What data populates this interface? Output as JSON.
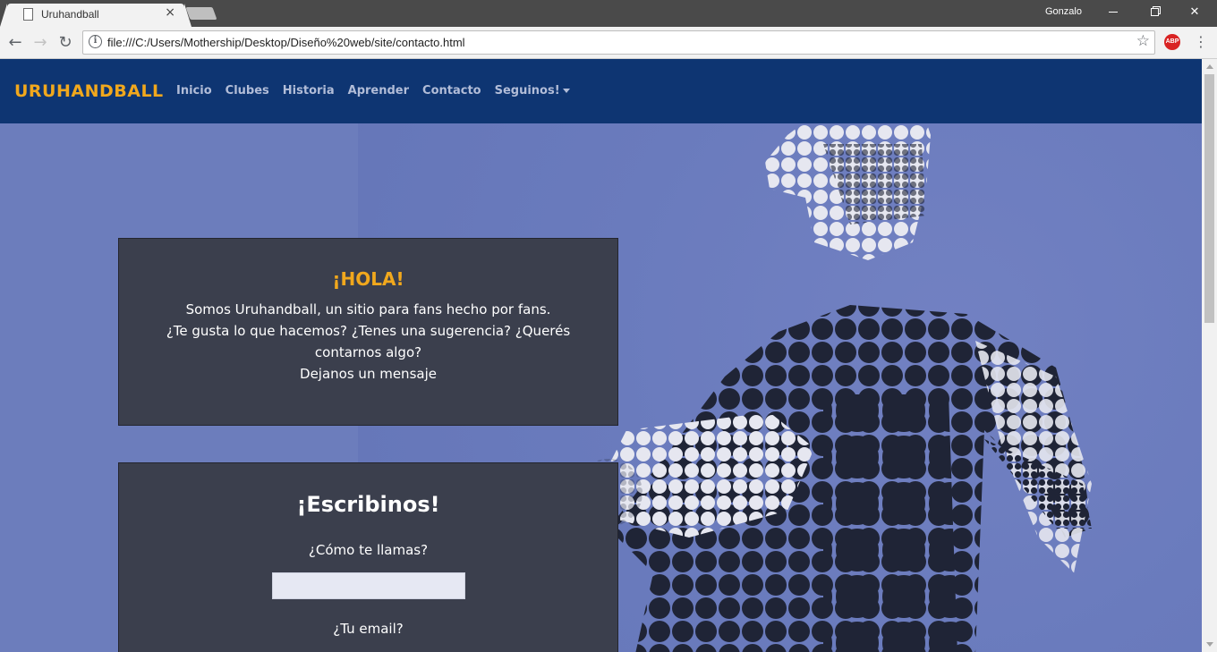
{
  "browser": {
    "tab_title": "Uruhandball",
    "tab_close": "×",
    "profile_name": "Gonzalo",
    "url": "file:///C:/Users/Mothership/Desktop/Diseño%20web/site/contacto.html",
    "abp_label": "ABP"
  },
  "site": {
    "brand": "URUHANDBALL",
    "nav": [
      "Inicio",
      "Clubes",
      "Historia",
      "Aprender",
      "Contacto",
      "Seguinos!"
    ]
  },
  "hola": {
    "heading": "¡HOLA!",
    "lines": [
      "Somos Uruhandball, un sitio para fans hecho por fans.",
      "¿Te gusta lo que hacemos? ¿Tenes una sugerencia? ¿Querés contarnos algo?",
      "Dejanos un mensaje"
    ]
  },
  "form": {
    "heading": "¡Escribinos!",
    "name_label": "¿Cómo te llamas?",
    "name_value": "",
    "email_label": "¿Tu email?"
  },
  "colors": {
    "navbar": "#0e3572",
    "brand": "#f1a81d",
    "card_bg": "#3b3f4d",
    "page_bg": "#6c7dbc"
  }
}
